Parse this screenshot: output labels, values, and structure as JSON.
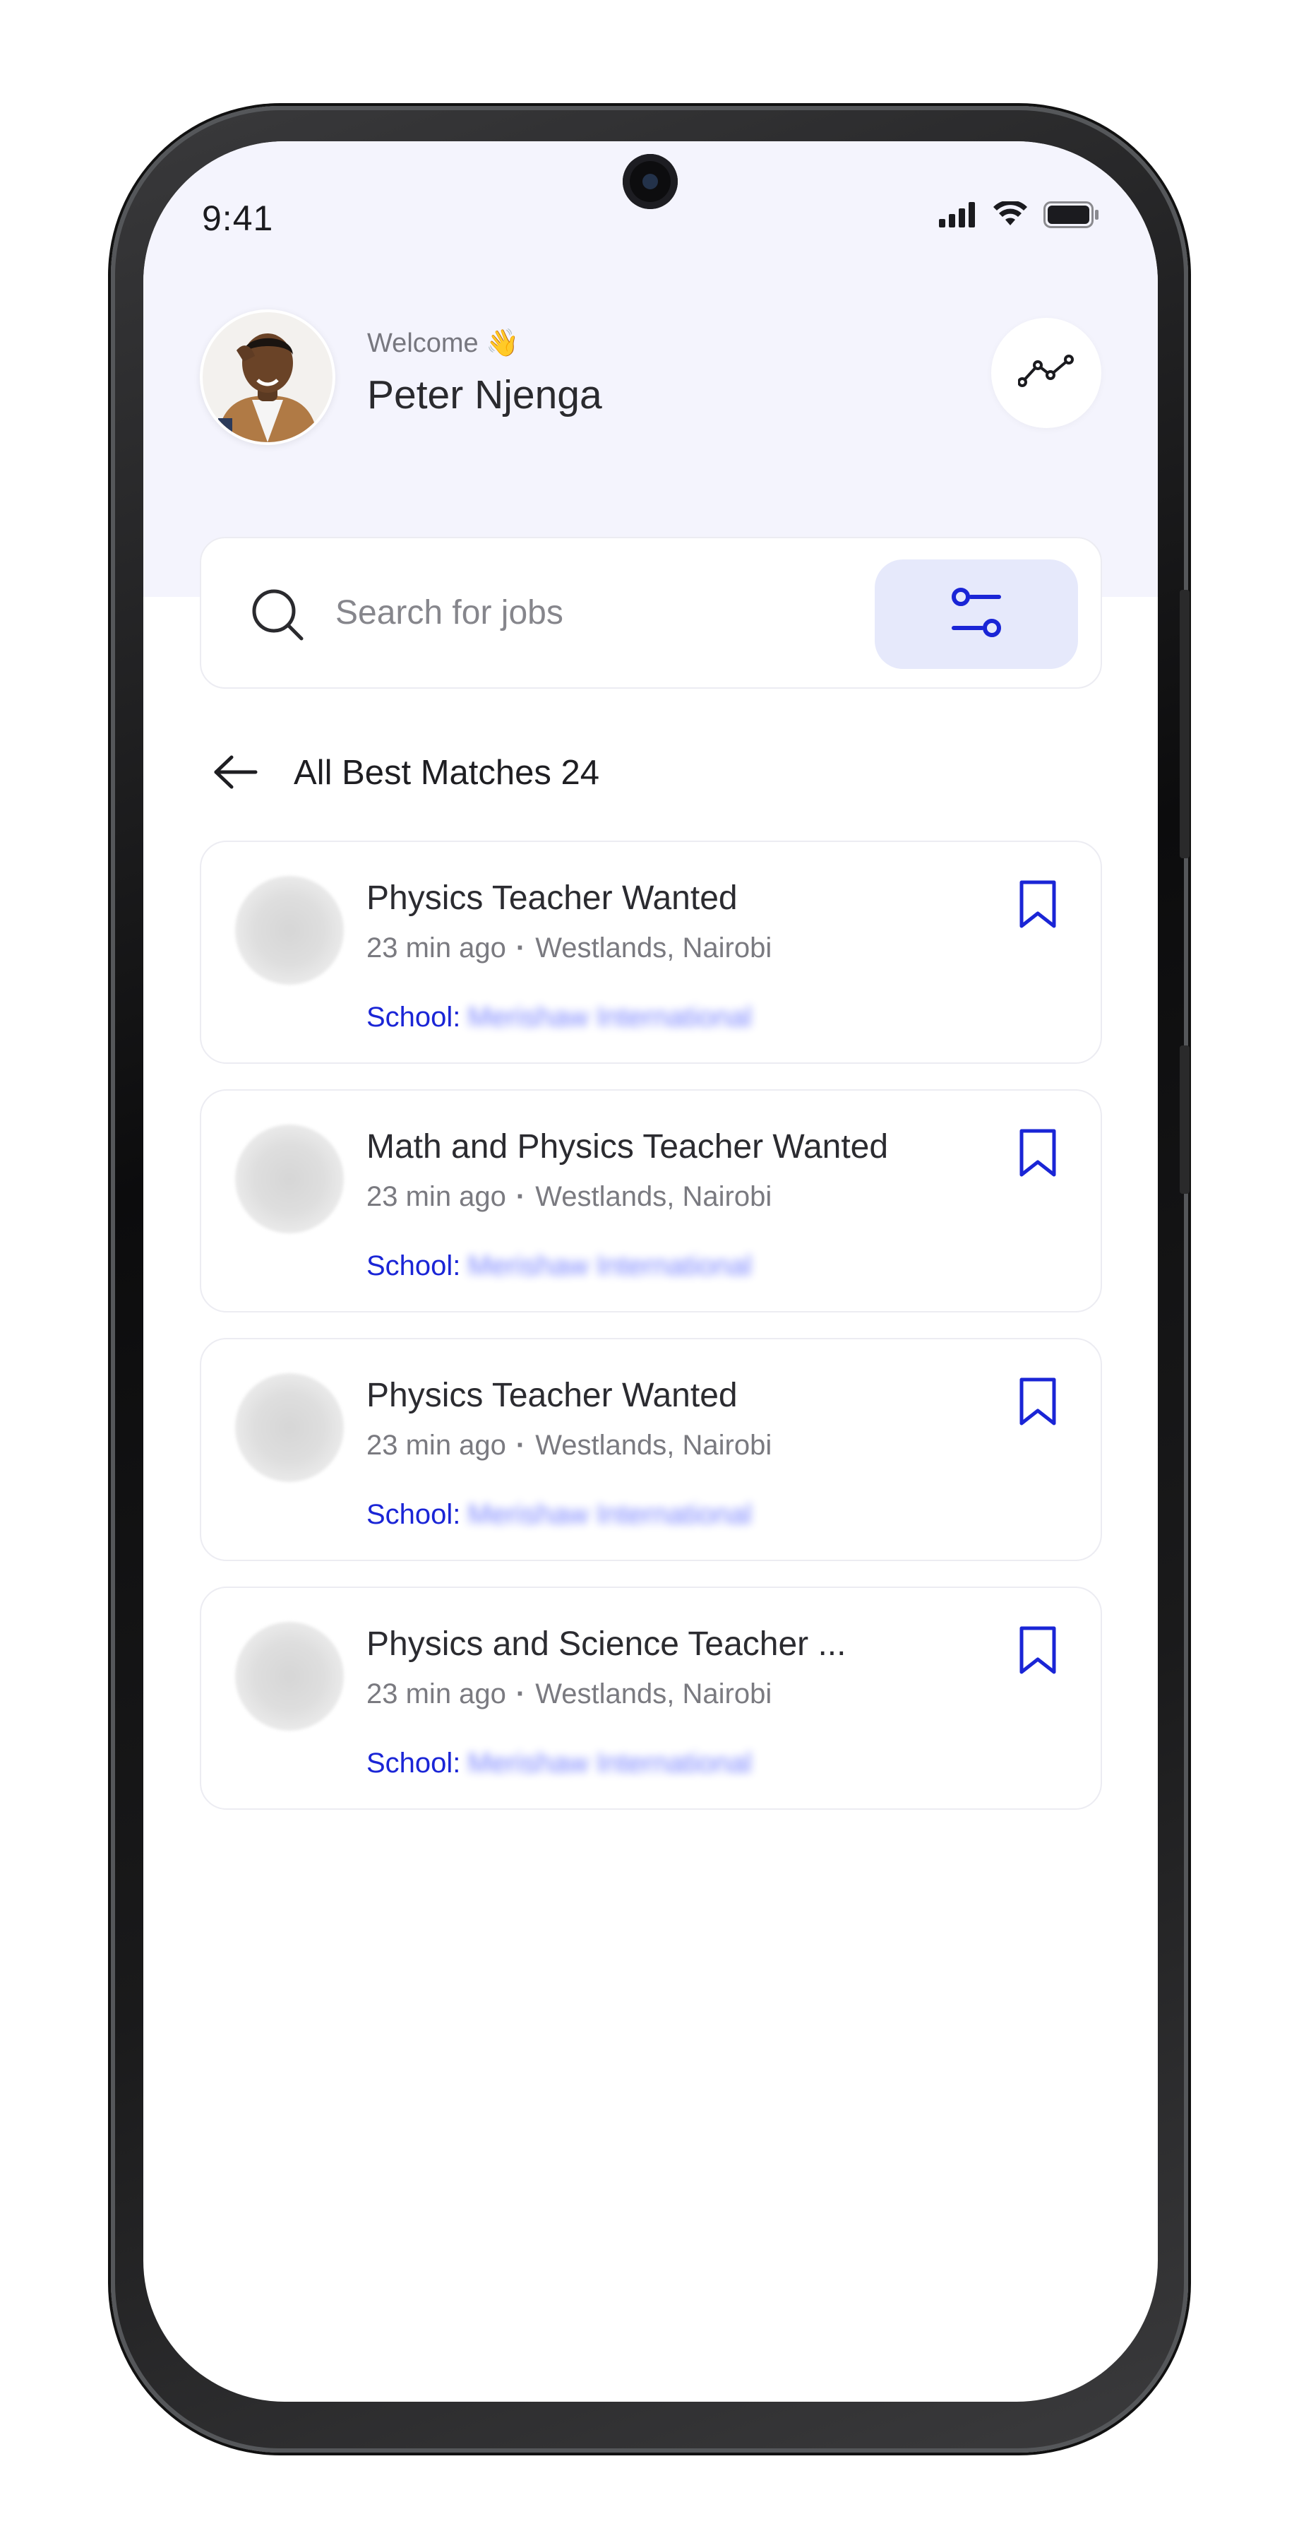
{
  "status_bar": {
    "time": "9:41",
    "icons": [
      "signal-icon",
      "wifi-icon",
      "battery-icon"
    ]
  },
  "profile": {
    "greeting": "Welcome 👋",
    "name": "Peter Njenga",
    "action_icon": "trend-chart-icon"
  },
  "search": {
    "placeholder": "Search for jobs",
    "value": "",
    "filter_icon": "filter-sliders-icon"
  },
  "section": {
    "title": "All Best Matches 24",
    "back_icon": "arrow-left-icon"
  },
  "jobs": [
    {
      "title": "Physics Teacher Wanted",
      "posted": "23 min ago",
      "location": "Westlands, Nairobi",
      "school_label": "School:",
      "school_name": "Merishaw International"
    },
    {
      "title": "Math and Physics Teacher Wanted",
      "posted": "23 min ago",
      "location": "Westlands, Nairobi",
      "school_label": "School:",
      "school_name": "Merishaw International"
    },
    {
      "title": "Physics Teacher Wanted",
      "posted": "23 min ago",
      "location": "Westlands, Nairobi",
      "school_label": "School:",
      "school_name": "Merishaw International"
    },
    {
      "title": "Physics and Science Teacher ...",
      "posted": "23 min ago",
      "location": "Westlands, Nairobi",
      "school_label": "School:",
      "school_name": "Merishaw International"
    }
  ],
  "colors": {
    "accent": "#1a25d6",
    "header_bg": "#f4f4fd",
    "filter_bg": "#e6e9fb"
  }
}
